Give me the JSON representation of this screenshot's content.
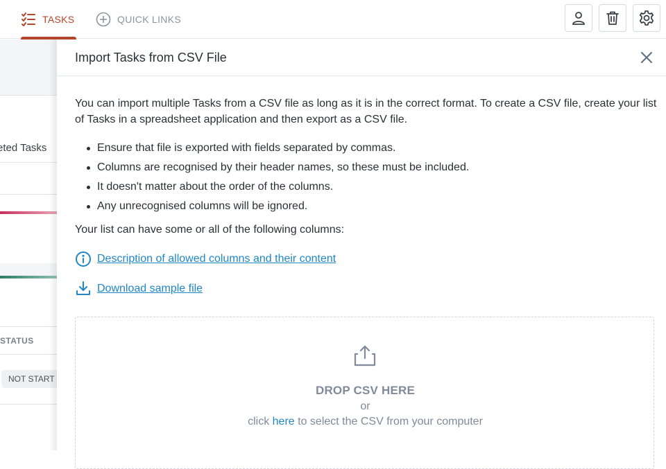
{
  "nav": {
    "tasks_label": "TASKS",
    "quick_links_label": "QUICK LINKS",
    "accent": "#b5452a",
    "icons": [
      "checklist-icon",
      "plus-circle-icon",
      "user-icon",
      "trash-icon",
      "gear-icon"
    ]
  },
  "background": {
    "completed_tasks_fragment": "eted Tasks",
    "status_header": "STATUS",
    "status_pill": "NOT START"
  },
  "dialog": {
    "title": "Import Tasks from CSV File",
    "intro": "You can import multiple Tasks from a CSV file as long as it is in the correct format. To create a CSV file, create your list of Tasks in a spreadsheet application and then export as a CSV file.",
    "bullets": [
      "Ensure that file is exported with fields separated by commas.",
      "Columns are recognised by their header names, so these must be included.",
      "It doesn't matter about the order of the columns.",
      "Any unrecognised columns will be ignored."
    ],
    "columns_text": "Your list can have some or all of the following columns:",
    "description_link": "Description of allowed columns and their content",
    "download_link": "Download sample file",
    "link_color": "#1f86c7",
    "dropzone": {
      "title": "DROP CSV HERE",
      "or": "or",
      "click_prefix": "click ",
      "here": "here",
      "click_suffix": " to select the CSV from your computer"
    }
  }
}
